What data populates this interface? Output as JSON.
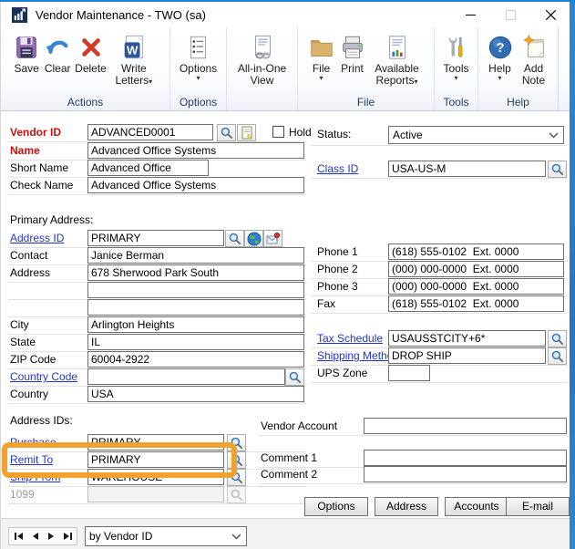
{
  "window": {
    "title": "Vendor Maintenance  -  TWO (sa)"
  },
  "toolbar": {
    "save": "Save",
    "clear": "Clear",
    "delete": "Delete",
    "write_letters": "Write Letters",
    "options": "Options",
    "all_in_one_view": "All-in-One View",
    "file": "File",
    "print": "Print",
    "available_reports": "Available Reports",
    "tools": "Tools",
    "help": "Help",
    "add_note": "Add Note",
    "groups": {
      "actions": "Actions",
      "options": "Options",
      "file": "File",
      "tools": "Tools",
      "help": "Help"
    }
  },
  "form": {
    "vendor_id": {
      "label": "Vendor ID",
      "value": "ADVANCED0001"
    },
    "hold": {
      "label": "Hold"
    },
    "name": {
      "label": "Name",
      "value": "Advanced Office Systems"
    },
    "short_name": {
      "label": "Short Name",
      "value": "Advanced Office"
    },
    "check_name": {
      "label": "Check Name",
      "value": "Advanced Office Systems"
    },
    "primary_address_heading": "Primary Address:",
    "address_id": {
      "label": "Address ID",
      "value": "PRIMARY"
    },
    "contact": {
      "label": "Contact",
      "value": "Janice Berman"
    },
    "address": {
      "label": "Address",
      "line1": "678 Sherwood Park South",
      "line2": "",
      "line3": ""
    },
    "city": {
      "label": "City",
      "value": "Arlington Heights"
    },
    "state": {
      "label": "State",
      "value": "IL"
    },
    "zip": {
      "label": "ZIP Code",
      "value": "60004-2922"
    },
    "country_code": {
      "label": "Country Code",
      "value": ""
    },
    "country": {
      "label": "Country",
      "value": "USA"
    },
    "address_ids_heading": "Address IDs:",
    "purchase": {
      "label": "Purchase",
      "value": "PRIMARY"
    },
    "remit_to": {
      "label": "Remit To",
      "value": "PRIMARY"
    },
    "ship_from": {
      "label": "Ship From",
      "value": "WAREHOUSE"
    },
    "ten99": {
      "label": "1099",
      "value": ""
    },
    "status": {
      "label": "Status:",
      "value": "Active"
    },
    "class_id": {
      "label": "Class ID",
      "value": "USA-US-M"
    },
    "phone1": {
      "label": "Phone 1",
      "value": "(618) 555-0102  Ext. 0000"
    },
    "phone2": {
      "label": "Phone 2",
      "value": "(000) 000-0000  Ext. 0000"
    },
    "phone3": {
      "label": "Phone 3",
      "value": "(000) 000-0000  Ext. 0000"
    },
    "fax": {
      "label": "Fax",
      "value": "(618) 555-0102  Ext. 0000"
    },
    "tax_schedule": {
      "label": "Tax Schedule",
      "value": "USAUSSTCITY+6*"
    },
    "shipping_method": {
      "label": "Shipping Method",
      "value": "DROP SHIP"
    },
    "ups_zone": {
      "label": "UPS Zone",
      "value": ""
    },
    "vendor_account": {
      "label": "Vendor Account",
      "value": ""
    },
    "comment1": {
      "label": "Comment 1",
      "value": ""
    },
    "comment2": {
      "label": "Comment 2",
      "value": ""
    }
  },
  "action_buttons": {
    "options": "Options",
    "address": "Address",
    "accounts": "Accounts",
    "email": "E-mail"
  },
  "record_browser": {
    "sort_by": "by Vendor ID"
  },
  "colors": {
    "titlebar_accent": "#1883d7",
    "highlight_box": "#f0a22c",
    "required_label": "#cc0000",
    "link_label": "#2135cd"
  }
}
